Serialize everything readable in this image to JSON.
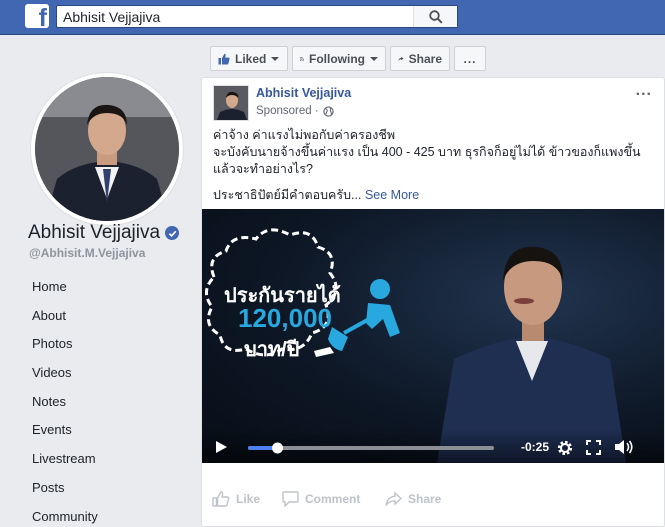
{
  "topbar": {
    "logo": "f",
    "search_value": "Abhisit Vejjajiva",
    "search_icon": "search-icon"
  },
  "profile": {
    "name": "Abhisit Vejjajiva",
    "handle": "@Abhisit.M.Vejjajiva",
    "verified_icon": "verified-badge-icon"
  },
  "nav": {
    "items": [
      "Home",
      "About",
      "Photos",
      "Videos",
      "Notes",
      "Events",
      "Livestream",
      "Posts",
      "Community"
    ]
  },
  "actions": {
    "liked": "Liked",
    "following": "Following",
    "share": "Share",
    "more": "..."
  },
  "post": {
    "author": "Abhisit Vejjajiva",
    "sponsored": "Sponsored ·",
    "more": "...",
    "line1": "ค่าจ้าง ค่าแรงไม่พอกับค่าครองชีพ",
    "line2": "จะบังคับนายจ้างขึ้นค่าแรง เป็น 400 - 425 บาท ธุรกิจก็อยู่ไม่ได้ ข้าวของก็แพงขึ้น",
    "line3": "แล้วจะทำอย่างไร?",
    "line4": "ประชาธิปัตย์มีคำตอบครับ...",
    "see_more": "See More"
  },
  "video": {
    "overlay_line1": "ประกันรายได้",
    "overlay_line2": "120,000",
    "overlay_line3": "บาท/ปี",
    "time": "-0:25",
    "progress": 0.12
  },
  "footer_actions": {
    "like": "Like",
    "comment": "Comment",
    "share": "Share"
  },
  "colors": {
    "brand": "#4267b2",
    "link": "#365899",
    "video_accent": "#29a8e0"
  }
}
